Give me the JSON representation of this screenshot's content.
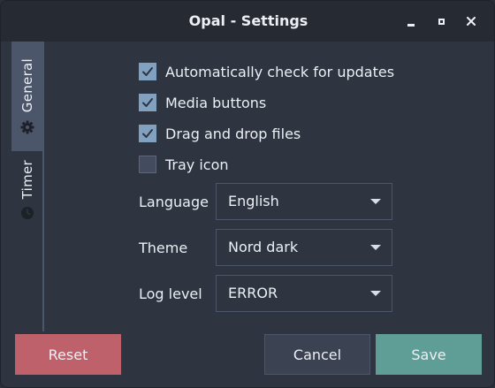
{
  "window": {
    "title": "Opal - Settings"
  },
  "tabs": [
    {
      "label": "General",
      "icon": "gear-icon",
      "selected": true
    },
    {
      "label": "Timer",
      "icon": "clock-icon",
      "selected": false
    }
  ],
  "checkboxes": [
    {
      "label": "Automatically check for updates",
      "checked": true
    },
    {
      "label": "Media buttons",
      "checked": true
    },
    {
      "label": "Drag and drop files",
      "checked": true
    },
    {
      "label": "Tray icon",
      "checked": false
    }
  ],
  "fields": {
    "language": {
      "label": "Language",
      "value": "English"
    },
    "theme": {
      "label": "Theme",
      "value": "Nord dark"
    },
    "log_level": {
      "label": "Log level",
      "value": "ERROR"
    }
  },
  "buttons": {
    "reset": "Reset",
    "cancel": "Cancel",
    "save": "Save"
  },
  "colors": {
    "background": "#2e3440",
    "accent": "#81a1c1",
    "reset": "#bf616a",
    "save": "#5f9e96"
  }
}
